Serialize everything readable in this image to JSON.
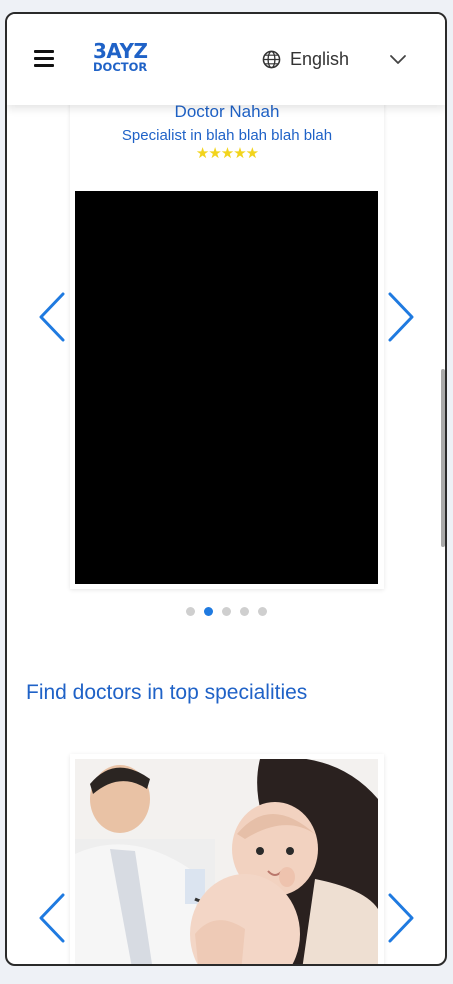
{
  "header": {
    "logo_line1": "3AYZ",
    "logo_line2": "DOCTOR",
    "language": "English"
  },
  "doctor_card": {
    "name": "Doctor Nahah",
    "specialty": "Specialist in blah blah blah blah",
    "rating_stars": "★★★★★",
    "rating": 5
  },
  "carousel": {
    "dot_count": 5,
    "active_index": 1
  },
  "sections": {
    "specialities_title": "Find doctors in top specialities"
  },
  "colors": {
    "brand_blue": "#1f62c7",
    "arrow_blue": "#1f7ae0",
    "star_yellow": "#f2d41c"
  },
  "icons": {
    "menu": "hamburger-icon",
    "language": "globe-icon",
    "dropdown": "chevron-down-icon",
    "prev": "chevron-left-icon",
    "next": "chevron-right-icon"
  }
}
